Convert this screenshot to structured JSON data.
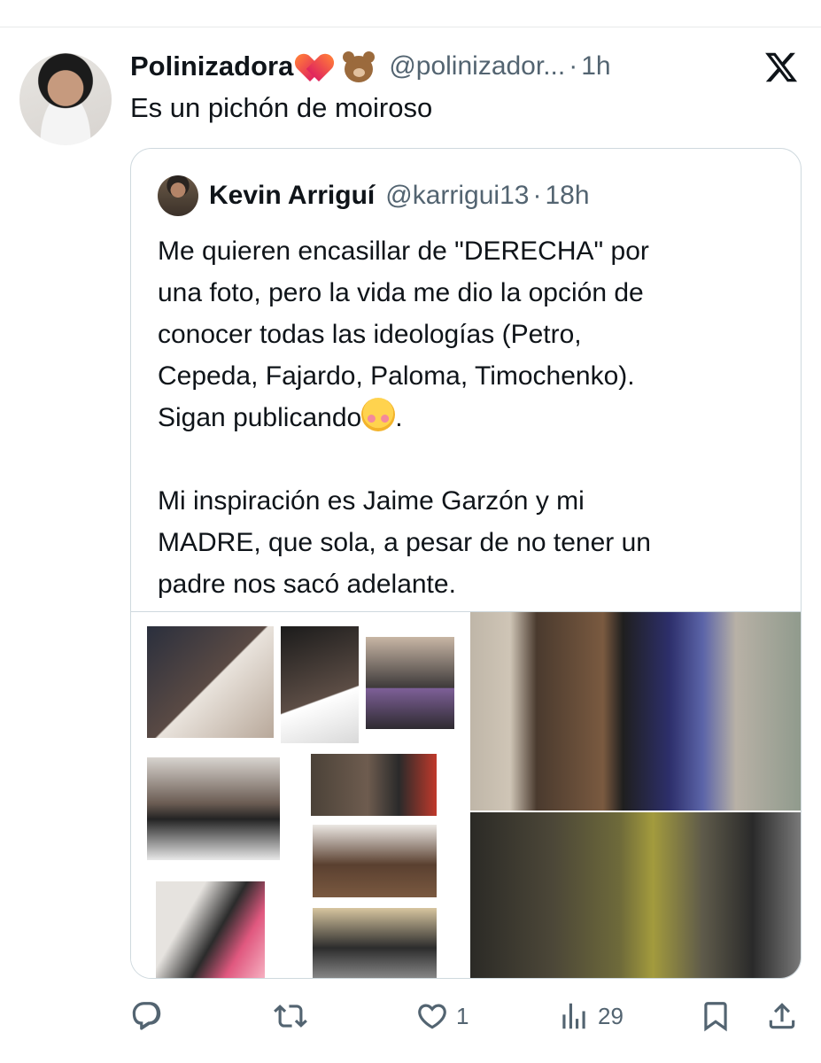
{
  "tweet": {
    "author_name": "Polinizadora",
    "author_handle": "@polinizador...",
    "separator": "·",
    "time": "1h",
    "text": "Es un pichón de moiroso",
    "header_icons": [
      "heart-on-fire-emoji",
      "bear-emoji"
    ]
  },
  "app_icon": "x-logo",
  "quoted": {
    "author_name": "Kevin Arriguí",
    "author_handle": "@karrigui13",
    "separator": "·",
    "time": "18h",
    "para1_lines": [
      "Me quieren encasillar de \"DERECHA\" por",
      "una foto, pero la vida me dio la opción de",
      "conocer todas las ideologías (Petro,",
      "Cepeda, Fajardo, Paloma, Timochenko)."
    ],
    "para1_last": "Sigan publicando",
    "para1_last_tail": ".",
    "para2_lines": [
      "Mi inspiración es Jaime Garzón y mi",
      "MADRE, que sola, a pesar de no tener un",
      "padre nos sacó adelante."
    ],
    "inline_emoji": "smiling-face-with-hearts-emoji"
  },
  "actions": {
    "reply_count": "",
    "repost_count": "",
    "like_count": "1",
    "views_count": "29"
  },
  "colors": {
    "text": "#0f1419",
    "secondary": "#536471",
    "border": "#cfd9de"
  }
}
